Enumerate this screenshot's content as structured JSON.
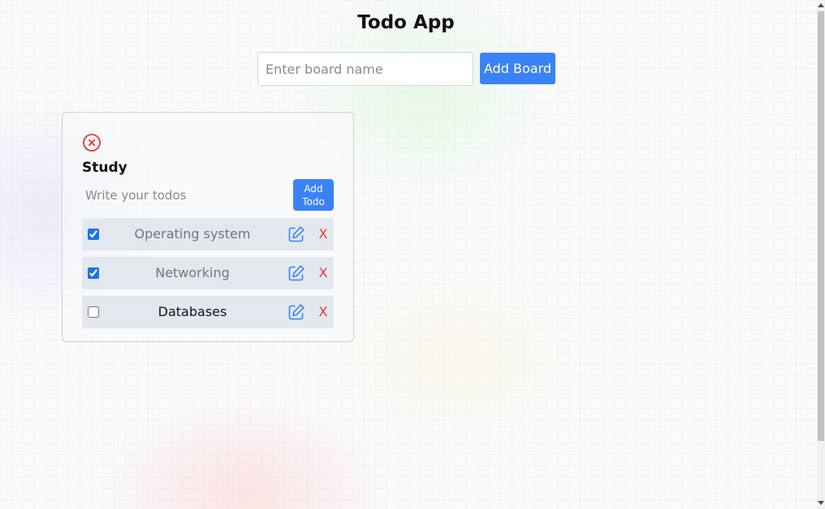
{
  "app": {
    "title": "Todo App"
  },
  "board_form": {
    "placeholder": "Enter board name",
    "value": "",
    "add_label": "Add Board"
  },
  "boards": [
    {
      "title": "Study",
      "delete_icon": "circle-x-icon",
      "todo_input": {
        "placeholder": "Write your todos",
        "value": ""
      },
      "add_todo_label_line1": "Add",
      "add_todo_label_line2": "Todo",
      "todos": [
        {
          "text": "Operating system",
          "done": true,
          "edit_icon": "edit-icon",
          "remove_label": "X"
        },
        {
          "text": "Networking",
          "done": true,
          "edit_icon": "edit-icon",
          "remove_label": "X"
        },
        {
          "text": "Databases",
          "done": false,
          "edit_icon": "edit-icon",
          "remove_label": "X"
        }
      ]
    }
  ],
  "colors": {
    "accent": "#3b82f6",
    "danger": "#e53935",
    "todo_row_bg": "#e3e7ee"
  }
}
